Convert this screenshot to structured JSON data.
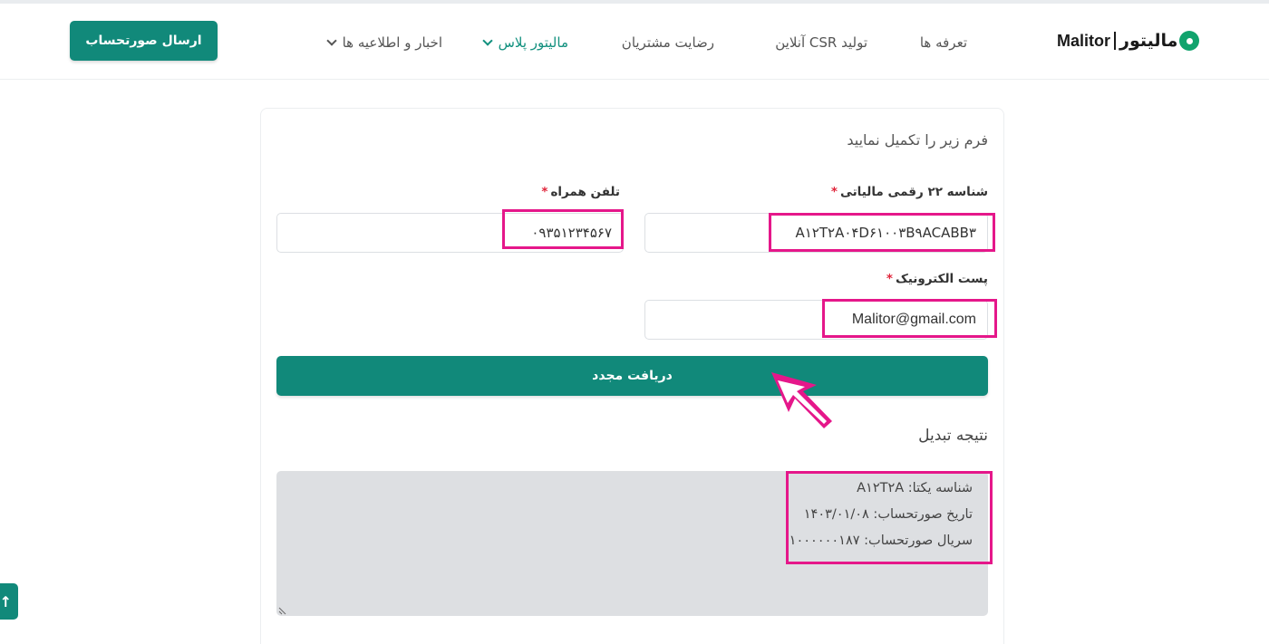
{
  "header": {
    "logo_latin": "Malitor",
    "logo_fa": "مالیتور",
    "nav": [
      {
        "label": "تعرفه ها"
      },
      {
        "label": "تولید CSR آنلاین"
      },
      {
        "label": "رضایت مشتریان"
      },
      {
        "label": "مالیتور پلاس"
      },
      {
        "label": "اخبار و اطلاعیه ها"
      }
    ],
    "send_invoice_button": "ارسال صورتحساب"
  },
  "form": {
    "title": "فرم زیر را تکمیل نمایید",
    "tax_id": {
      "label": "شناسه ۲۲ رقمی مالیاتی",
      "required_mark": "*",
      "value": "A۱۲T۲A۰۴D۶۱۰۰۳B۹ACABB۳"
    },
    "phone": {
      "label": "تلفن همراه",
      "required_mark": "*",
      "value": "۰۹۳۵۱۲۳۴۵۶۷"
    },
    "email": {
      "label": "پست الکترونیک",
      "required_mark": "*",
      "value": "Malitor@gmail.com"
    },
    "submit_button": "دریافت مجدد"
  },
  "result": {
    "title": "نتیجه تبدیل",
    "lines": [
      "شناسه یکتا: A۱۲T۲A",
      "تاریخ صورتحساب: ۱۴۰۳/۰۱/۰۸",
      "سریال صورتحساب: ۱۰۰۰۰۰۰۱۸۷"
    ]
  },
  "colors": {
    "primary": "#11897a",
    "highlight": "#e5178a",
    "required": "#e0243a",
    "result_bg": "#dddfe2"
  },
  "icons": {
    "dropdown": "chevron-down-icon",
    "scroll_top": "arrow-up-icon",
    "annotation": "arrow-pointer-icon"
  }
}
